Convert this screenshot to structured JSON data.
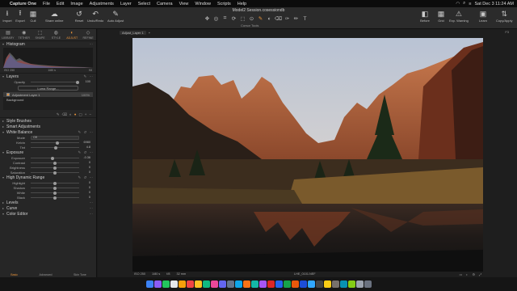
{
  "menubar": {
    "items": [
      "Capture One",
      "File",
      "Edit",
      "Image",
      "Adjustments",
      "Layer",
      "Select",
      "Camera",
      "View",
      "Window",
      "Scripts",
      "Help"
    ],
    "datetime": "Sat Dec 3  11:24 AM"
  },
  "toolbar": {
    "doc_title": "Model2 Session.cosessiondb",
    "buttons": [
      {
        "label": "Import",
        "icon": "import-icon"
      },
      {
        "label": "Export",
        "icon": "export-icon"
      },
      {
        "label": "Cull",
        "icon": "cull-icon"
      },
      {
        "label": "Share online",
        "icon": "share-icon"
      },
      {
        "label": "Reset",
        "icon": "reset-icon"
      },
      {
        "label": "Undo/Redo",
        "icon": "undo-icon"
      },
      {
        "label": "Auto Adjust",
        "icon": "auto-adjust-icon"
      },
      {
        "label": "Before",
        "icon": "before-icon"
      },
      {
        "label": "Grid",
        "icon": "grid-icon"
      },
      {
        "label": "Exp. Warning",
        "icon": "warning-icon"
      },
      {
        "label": "Learn",
        "icon": "learn-icon"
      },
      {
        "label": "Copy/Apply",
        "icon": "copy-apply-icon"
      }
    ],
    "cursor_tools_label": "Cursor Tools"
  },
  "tool_tabs": [
    {
      "label": "LIBRARY",
      "active": false
    },
    {
      "label": "TETHER",
      "active": false
    },
    {
      "label": "SHAPE",
      "active": false
    },
    {
      "label": "STYLE",
      "active": false
    },
    {
      "label": "ADJUST",
      "active": true
    },
    {
      "label": "REFINE",
      "active": false
    }
  ],
  "histogram": {
    "title": "Histogram",
    "iso": "ISO 250",
    "shutter": "1/80 s",
    "aperture": "f/8"
  },
  "layers": {
    "title": "Layers",
    "opacity_label": "Opacity",
    "opacity_value": "100",
    "luma_range_label": "Luma Range...",
    "items": [
      {
        "name": "Adjustment Layer 1",
        "opacity": "100%",
        "selected": true
      },
      {
        "name": "Background",
        "opacity": "",
        "selected": false
      }
    ]
  },
  "sections": {
    "style_brushes": "Style Brushes",
    "smart_adjustments": "Smart Adjustments",
    "white_balance": "White Balance",
    "exposure": "Exposure",
    "hdr": "High Dynamic Range",
    "levels": "Levels",
    "curve": "Curve",
    "color_editor": "Color Editor"
  },
  "white_balance": {
    "mode_label": "Mode",
    "mode_value": "Off",
    "rows": [
      {
        "label": "Kelvin",
        "value": "6980",
        "pos": 0.55
      },
      {
        "label": "Tint",
        "value": "4.8",
        "pos": 0.52
      }
    ]
  },
  "exposure": {
    "rows": [
      {
        "label": "Exposure",
        "value": "-0.36",
        "pos": 0.45
      },
      {
        "label": "Contrast",
        "value": "0",
        "pos": 0.5
      },
      {
        "label": "Brightness",
        "value": "0",
        "pos": 0.5
      },
      {
        "label": "Saturation",
        "value": "0",
        "pos": 0.5
      }
    ]
  },
  "hdr": {
    "rows": [
      {
        "label": "Highlight",
        "value": "0",
        "pos": 0.5
      },
      {
        "label": "Shadow",
        "value": "0",
        "pos": 0.5
      },
      {
        "label": "White",
        "value": "0",
        "pos": 0.5
      },
      {
        "label": "Black",
        "value": "0",
        "pos": 0.5
      }
    ]
  },
  "color_editor_tabs": {
    "basic": "Basic",
    "advanced": "Advanced",
    "skin_tone": "Skin Tone"
  },
  "viewer": {
    "tab_label": "Adjust_Layer 1",
    "f_label": "F3",
    "exif": {
      "iso": "ISO 250",
      "shutter": "1/80 s",
      "aperture": "f/8",
      "focal": "32 mm"
    },
    "filename": "LHE_0101.NEF"
  },
  "colors": {
    "accent": "#e6923a",
    "panel": "#262626",
    "background": "#1a1a1a"
  }
}
